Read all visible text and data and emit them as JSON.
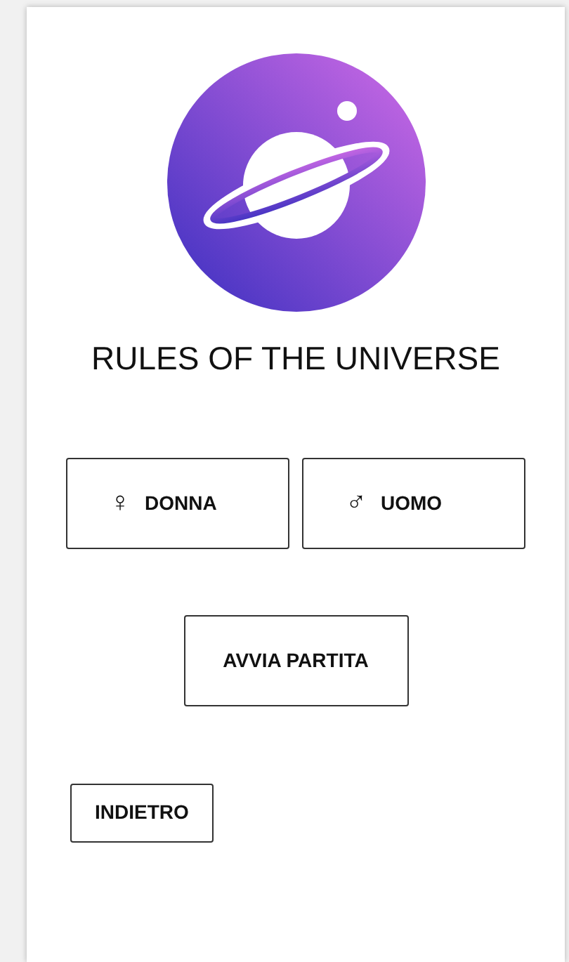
{
  "title": "RULES OF THE UNIVERSE",
  "gender_options": [
    {
      "symbol": "♀",
      "label": "DONNA"
    },
    {
      "symbol": "♂",
      "label": "UOMO"
    }
  ],
  "start_button": "AVVIA PARTITA",
  "back_button": "INDIETRO"
}
